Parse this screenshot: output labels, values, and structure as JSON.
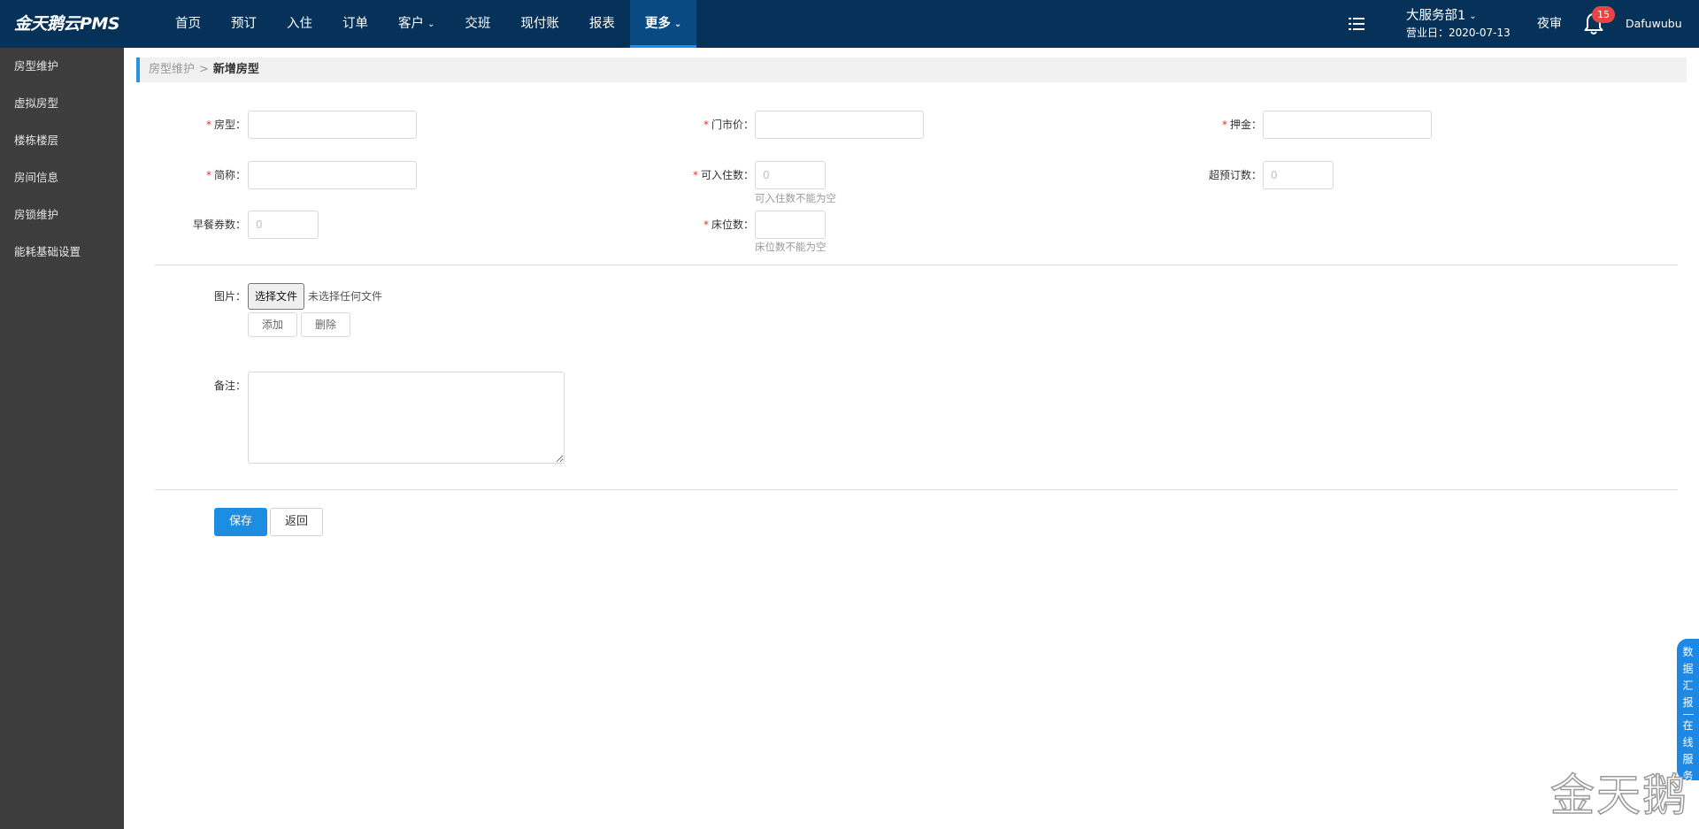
{
  "app": {
    "logo": "金天鹅云PMS"
  },
  "nav": {
    "items": [
      "首页",
      "预订",
      "入住",
      "订单",
      "客户",
      "交班",
      "现付账",
      "报表",
      "更多"
    ],
    "active": "更多"
  },
  "header": {
    "store_name": "大服务部1",
    "business_date": "营业日：2020-07-13",
    "night_audit": "夜审",
    "notification_count": "15",
    "username": "Dafuwubu"
  },
  "sidebar": {
    "items": [
      "房型维护",
      "虚拟房型",
      "楼栋楼层",
      "房间信息",
      "房锁维护",
      "能耗基础设置"
    ]
  },
  "breadcrumb": {
    "parent": "房型维护",
    "separator": ">",
    "current": "新增房型"
  },
  "form": {
    "room_type": {
      "label": "房型：",
      "value": ""
    },
    "door_price": {
      "label": "门市价：",
      "value": ""
    },
    "deposit": {
      "label": "押金：",
      "value": ""
    },
    "short_name": {
      "label": "简称：",
      "value": ""
    },
    "capacity": {
      "label": "可入住数：",
      "value": "",
      "placeholder": "0",
      "hint": "可入住数不能为空"
    },
    "overbook": {
      "label": "超预订数：",
      "value": "",
      "placeholder": "0"
    },
    "breakfast": {
      "label": "早餐券数：",
      "value": "",
      "placeholder": "0"
    },
    "beds": {
      "label": "床位数：",
      "value": "",
      "hint": "床位数不能为空"
    },
    "image": {
      "label": "图片：",
      "choose_file": "选择文件",
      "no_file": "未选择任何文件",
      "add": "添加",
      "delete": "删除"
    },
    "remark": {
      "label": "备注：",
      "value": ""
    },
    "save": "保存",
    "back": "返回"
  },
  "float_tab": {
    "part1": "数据汇报",
    "part2": "在线服务"
  },
  "watermark": "金天鹅"
}
